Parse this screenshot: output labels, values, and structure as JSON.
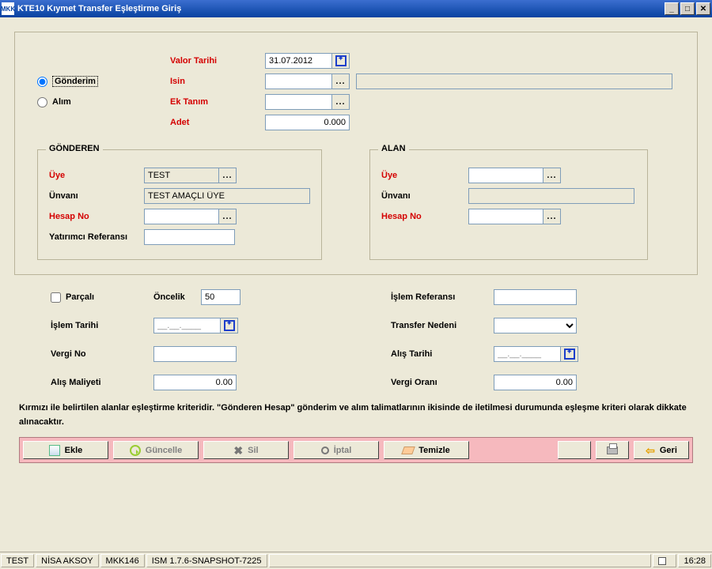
{
  "window": {
    "title": "KTE10 Kıymet Transfer Eşleştirme Giriş"
  },
  "top": {
    "valor_label": "Valor Tarihi",
    "valor_value": "31.07.2012",
    "isin_label": "Isin",
    "isin_value": "",
    "ektanim_label": "Ek Tanım",
    "ektanim_value": "",
    "adet_label": "Adet",
    "adet_value": "0.000",
    "radio_gonderim": "Gönderim",
    "radio_alim": "Alım"
  },
  "gonderen": {
    "caption": "GÖNDEREN",
    "uye_label": "Üye",
    "uye_value": "TEST",
    "unvan_label": "Ünvanı",
    "unvan_value": "TEST AMAÇLI ÜYE",
    "hesap_label": "Hesap No",
    "hesap_value": "",
    "yref_label": "Yatırımcı Referansı",
    "yref_value": ""
  },
  "alan": {
    "caption": "ALAN",
    "uye_label": "Üye",
    "uye_value": "",
    "unvan_label": "Ünvanı",
    "unvan_value": "",
    "hesap_label": "Hesap No",
    "hesap_value": ""
  },
  "lower": {
    "parcali_label": "Parçalı",
    "oncelik_label": "Öncelik",
    "oncelik_value": "50",
    "islemref_label": "İşlem Referansı",
    "islemref_value": "",
    "islemtarih_label": "İşlem Tarihi",
    "islemtarih_value": "__.__.____",
    "transferneden_label": "Transfer Nedeni",
    "transferneden_value": "",
    "vergino_label": "Vergi No",
    "vergino_value": "",
    "alistarih_label": "Alış Tarihi",
    "alistarih_value": "__.__.____",
    "alismaliyet_label": "Alış Maliyeti",
    "alismaliyet_value": "0.00",
    "vergioran_label": "Vergi Oranı",
    "vergioran_value": "0.00"
  },
  "note": "Kırmızı ile belirtilen alanlar eşleştirme kriteridir. \"Gönderen Hesap\" gönderim ve alım talimatlarının ikisinde de iletilmesi durumunda eşleşme kriteri olarak dikkate alınacaktır.",
  "toolbar": {
    "ekle": "Ekle",
    "guncelle": "Güncelle",
    "sil": "Sil",
    "iptal": "İptal",
    "temizle": "Temizle",
    "geri": "Geri"
  },
  "status": {
    "s1": "TEST",
    "s2": "NİSA AKSOY",
    "s3": "MKK146",
    "s4": "ISM 1.7.6-SNAPSHOT-7225",
    "time": "16:28"
  }
}
